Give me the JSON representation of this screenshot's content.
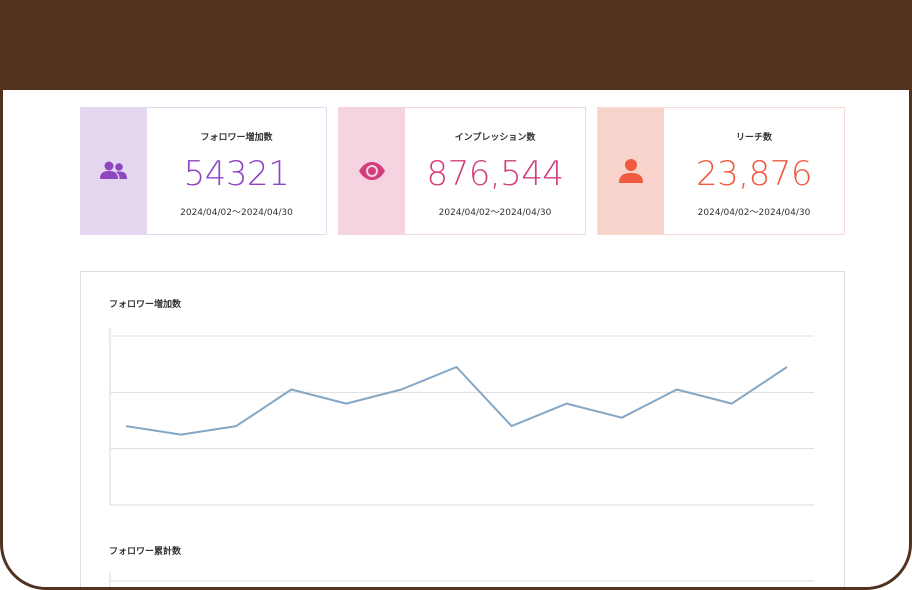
{
  "colors": {
    "frame": "#52321f",
    "followers_accent": "#8e45c0",
    "impressions_accent": "#d23d7d",
    "reach_accent": "#ef5a40",
    "line": "#84a7c6"
  },
  "cards": [
    {
      "label": "フォロワー増加数",
      "value": "54321",
      "range": "2024/04/02〜2024/04/30",
      "icon": "users-icon"
    },
    {
      "label": "インプレッション数",
      "value": "876,544",
      "range": "2024/04/02〜2024/04/30",
      "icon": "eye-icon"
    },
    {
      "label": "リーチ数",
      "value": "23,876",
      "range": "2024/04/02〜2024/04/30",
      "icon": "person-icon"
    }
  ],
  "charts": {
    "followers_increase_title": "フォロワー増加数",
    "followers_total_title": "フォロワー累計数"
  },
  "chart_data": [
    {
      "type": "line",
      "title": "フォロワー増加数",
      "series": [
        {
          "values": [
            1.4,
            1.25,
            1.4,
            2.05,
            1.8,
            2.05,
            2.45,
            1.4,
            1.8,
            1.55,
            2.05,
            1.8,
            2.45
          ]
        }
      ],
      "ylim": [
        0,
        3
      ],
      "grid": true
    },
    {
      "type": "line",
      "title": "フォロワー累計数",
      "series": [],
      "grid": true
    }
  ]
}
